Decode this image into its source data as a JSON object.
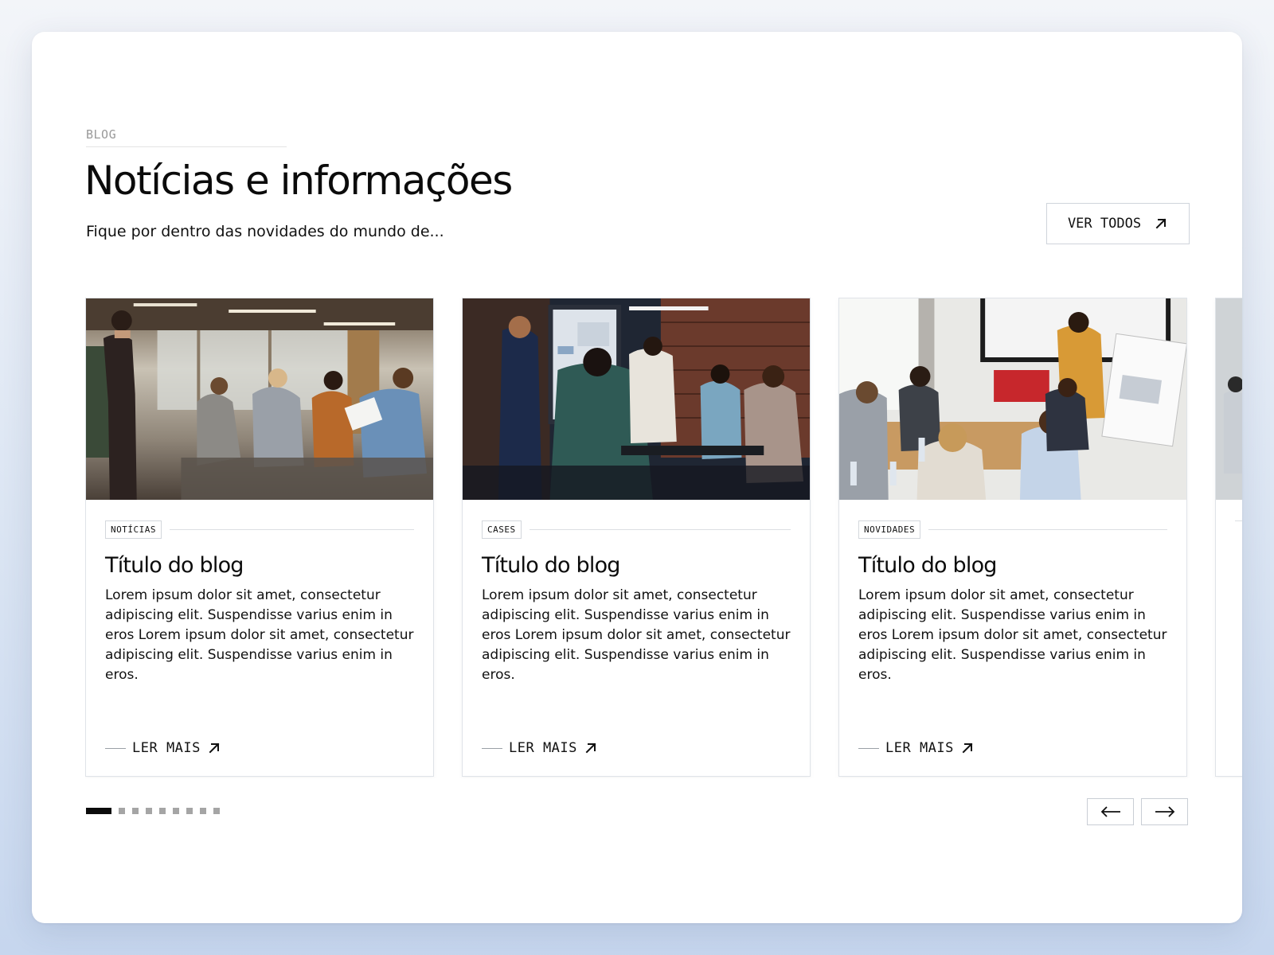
{
  "header": {
    "eyebrow": "BLOG",
    "title": "Notícias e informações",
    "subtitle": "Fique por dentro das novidades do mundo de...",
    "view_all_label": "VER TODOS",
    "view_all_icon": "arrow-up-right-icon"
  },
  "cards": [
    {
      "tag": "NOTÍCIAS",
      "title": "Título do blog",
      "text": "Lorem ipsum dolor sit amet, consectetur adipiscing elit. Suspendisse varius enim in eros Lorem ipsum dolor sit amet, consectetur adipiscing elit. Suspendisse varius enim in eros.",
      "read_more": "LER MAIS",
      "image": "photo-office-presentation"
    },
    {
      "tag": "CASES",
      "title": "Título do blog",
      "text": "Lorem ipsum dolor sit amet, consectetur adipiscing elit. Suspendisse varius enim in eros Lorem ipsum dolor sit amet, consectetur adipiscing elit. Suspendisse varius enim in eros.",
      "read_more": "LER MAIS",
      "image": "photo-team-meeting-dark"
    },
    {
      "tag": "NOVIDADES",
      "title": "Título do blog",
      "text": "Lorem ipsum dolor sit amet, consectetur adipiscing elit. Suspendisse varius enim in eros Lorem ipsum dolor sit amet, consectetur adipiscing elit. Suspendisse varius enim in eros.",
      "read_more": "LER MAIS",
      "image": "photo-whiteboard-meeting"
    }
  ],
  "carousel": {
    "total_pages": 9,
    "current_page": 1,
    "prev_icon": "arrow-left-icon",
    "next_icon": "arrow-right-icon"
  },
  "colors": {
    "text": "#0b0b0b",
    "muted": "#9a9a9a",
    "border": "#dfe3e8",
    "dot_inactive": "#a5a5a5",
    "background_top": "#f3f5f9",
    "background_bottom": "#c6d6ee"
  }
}
